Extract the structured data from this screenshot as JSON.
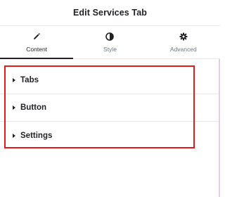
{
  "header": {
    "title": "Edit Services Tab"
  },
  "tabs": [
    {
      "label": "Content",
      "icon": "pencil-icon",
      "active": true
    },
    {
      "label": "Style",
      "icon": "contrast-icon",
      "active": false
    },
    {
      "label": "Advanced",
      "icon": "gear-icon",
      "active": false
    }
  ],
  "sections": [
    {
      "label": "Tabs",
      "icon": "caret-right-icon"
    },
    {
      "label": "Button",
      "icon": "caret-right-icon"
    },
    {
      "label": "Settings",
      "icon": "caret-right-icon"
    }
  ],
  "colors": {
    "text": "#1f2124",
    "muted": "#6d7882",
    "border": "#e6e8ea",
    "highlight": "#e01b1b"
  }
}
